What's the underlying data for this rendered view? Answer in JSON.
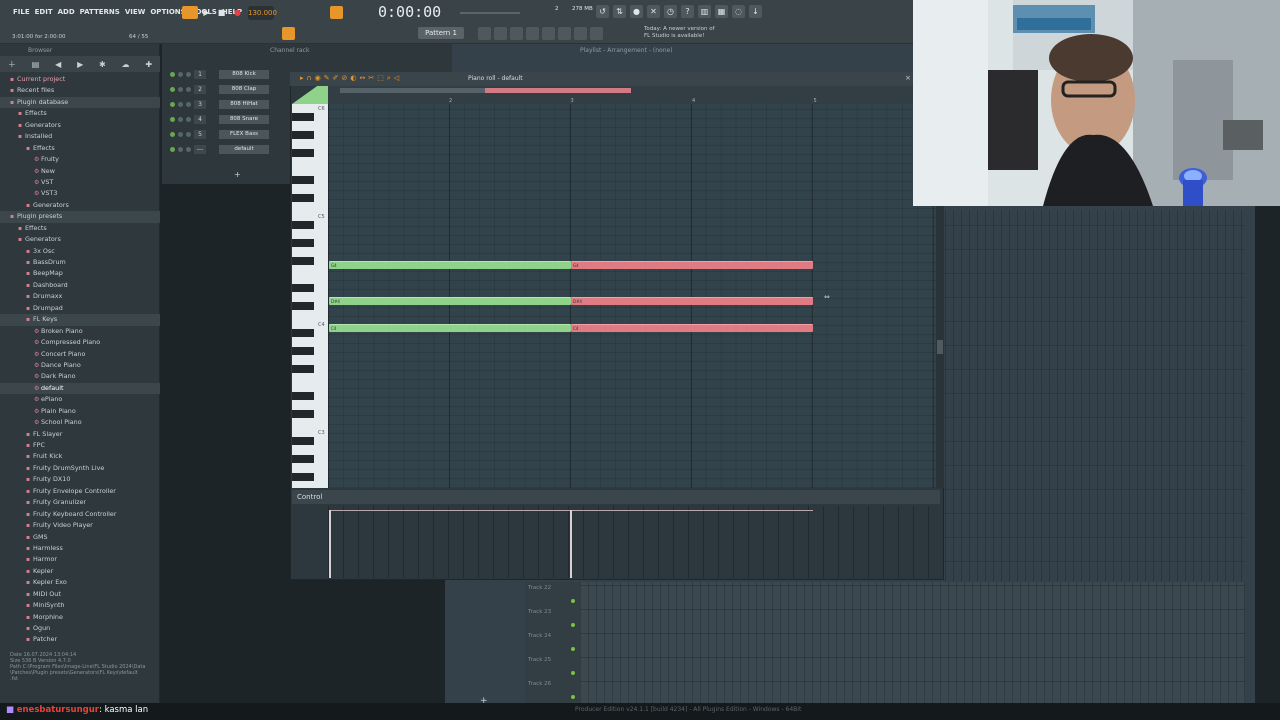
{
  "menu": [
    "FILE",
    "EDIT",
    "ADD",
    "PATTERNS",
    "VIEW",
    "OPTIONS",
    "TOOLS",
    "HELP"
  ],
  "transport": {
    "bpm": "130.000",
    "time": "0:00:00",
    "pattern": "Pattern 1",
    "cpu": "2",
    "mem": "278 MB"
  },
  "news": {
    "line1": "Today: A newer version of",
    "line2": "FL Studio is available!"
  },
  "hint": "3:01:00 for 2:00:00",
  "hint_right": "64 / 55",
  "browser": {
    "title": "Browser",
    "items": [
      {
        "label": "Current project",
        "indent": 0,
        "style": "pink"
      },
      {
        "label": "Recent files",
        "indent": 0,
        "style": "normal"
      },
      {
        "label": "Plugin database",
        "indent": 0,
        "style": "hl"
      },
      {
        "label": "Effects",
        "indent": 1,
        "style": "normal"
      },
      {
        "label": "Generators",
        "indent": 1,
        "style": "normal"
      },
      {
        "label": "Installed",
        "indent": 1,
        "style": "normal"
      },
      {
        "label": "Effects",
        "indent": 2,
        "style": "normal"
      },
      {
        "label": "Fruity",
        "indent": 3,
        "style": "normal"
      },
      {
        "label": "New",
        "indent": 3,
        "style": "normal"
      },
      {
        "label": "VST",
        "indent": 3,
        "style": "normal"
      },
      {
        "label": "VST3",
        "indent": 3,
        "style": "normal"
      },
      {
        "label": "Generators",
        "indent": 2,
        "style": "normal"
      },
      {
        "label": "Plugin presets",
        "indent": 0,
        "style": "hl"
      },
      {
        "label": "Effects",
        "indent": 1,
        "style": "normal"
      },
      {
        "label": "Generators",
        "indent": 1,
        "style": "normal"
      },
      {
        "label": "3x Osc",
        "indent": 2,
        "style": "normal"
      },
      {
        "label": "BassDrum",
        "indent": 2,
        "style": "normal"
      },
      {
        "label": "BeepMap",
        "indent": 2,
        "style": "normal"
      },
      {
        "label": "Dashboard",
        "indent": 2,
        "style": "normal"
      },
      {
        "label": "Drumaxx",
        "indent": 2,
        "style": "normal"
      },
      {
        "label": "Drumpad",
        "indent": 2,
        "style": "normal"
      },
      {
        "label": "FL Keys",
        "indent": 2,
        "style": "hl"
      },
      {
        "label": "Broken Piano",
        "indent": 3,
        "style": "normal"
      },
      {
        "label": "Compressed Piano",
        "indent": 3,
        "style": "normal"
      },
      {
        "label": "Concert Piano",
        "indent": 3,
        "style": "normal"
      },
      {
        "label": "Dance Piano",
        "indent": 3,
        "style": "normal"
      },
      {
        "label": "Dark Piano",
        "indent": 3,
        "style": "normal"
      },
      {
        "label": "default",
        "indent": 3,
        "style": "sel"
      },
      {
        "label": "ePiano",
        "indent": 3,
        "style": "normal"
      },
      {
        "label": "Plain Piano",
        "indent": 3,
        "style": "normal"
      },
      {
        "label": "School Piano",
        "indent": 3,
        "style": "normal"
      },
      {
        "label": "FL Slayer",
        "indent": 2,
        "style": "normal"
      },
      {
        "label": "FPC",
        "indent": 2,
        "style": "normal"
      },
      {
        "label": "Fruit Kick",
        "indent": 2,
        "style": "normal"
      },
      {
        "label": "Fruity DrumSynth Live",
        "indent": 2,
        "style": "normal"
      },
      {
        "label": "Fruity DX10",
        "indent": 2,
        "style": "normal"
      },
      {
        "label": "Fruity Envelope Controller",
        "indent": 2,
        "style": "normal"
      },
      {
        "label": "Fruity Granulizer",
        "indent": 2,
        "style": "normal"
      },
      {
        "label": "Fruity Keyboard Controller",
        "indent": 2,
        "style": "normal"
      },
      {
        "label": "Fruity Video Player",
        "indent": 2,
        "style": "normal"
      },
      {
        "label": "GMS",
        "indent": 2,
        "style": "normal"
      },
      {
        "label": "Harmless",
        "indent": 2,
        "style": "normal"
      },
      {
        "label": "Harmor",
        "indent": 2,
        "style": "normal"
      },
      {
        "label": "Kepler",
        "indent": 2,
        "style": "normal"
      },
      {
        "label": "Kepler Exo",
        "indent": 2,
        "style": "normal"
      },
      {
        "label": "MIDI Out",
        "indent": 2,
        "style": "normal"
      },
      {
        "label": "MiniSynth",
        "indent": 2,
        "style": "normal"
      },
      {
        "label": "Morphine",
        "indent": 2,
        "style": "normal"
      },
      {
        "label": "Ogun",
        "indent": 2,
        "style": "normal"
      },
      {
        "label": "Patcher",
        "indent": 2,
        "style": "normal"
      }
    ],
    "info": [
      "Date   16.07.2024 13:04:14",
      "Size   536 B        Version 4.7.0",
      "Path   C:\\Program Files\\Image-Line\\FL Studio 2024\\Data",
      "         \\Patches\\Plugin presets\\Generators\\FL Keys\\default",
      "         .fst"
    ]
  },
  "channel_rack": {
    "title": "Channel rack",
    "channels": [
      {
        "num": "1",
        "name": "808 Kick"
      },
      {
        "num": "2",
        "name": "808 Clap"
      },
      {
        "num": "3",
        "name": "808 HiHat"
      },
      {
        "num": "4",
        "name": "808 Snare"
      },
      {
        "num": "5",
        "name": "FLEX Bass"
      },
      {
        "num": "---",
        "name": "default"
      }
    ]
  },
  "playlist": {
    "title": "Playlist - Arrangement - (none)",
    "tracks": [
      "Track 22",
      "Track 23",
      "Track 24",
      "Track 25",
      "Track 26"
    ]
  },
  "piano_roll": {
    "title": "Piano roll - default",
    "ruler": [
      "2",
      "3",
      "4",
      "5"
    ],
    "key_labels": [
      "C6",
      "C5",
      "C4",
      "C3"
    ],
    "control_label": "Control",
    "notes": [
      {
        "row": 0,
        "green_label": "G4",
        "red_label": "G4"
      },
      {
        "row": 1,
        "green_label": "D#4",
        "red_label": "D#4"
      },
      {
        "row": 2,
        "green_label": "C4",
        "red_label": "C4"
      }
    ]
  },
  "chat": {
    "user": "enesbatursungur",
    "message": ": kasma lan"
  },
  "status_bar": "Producer Edition v24.1.1 [build 4234] - All Plugins Edition - Windows - 64Bit"
}
